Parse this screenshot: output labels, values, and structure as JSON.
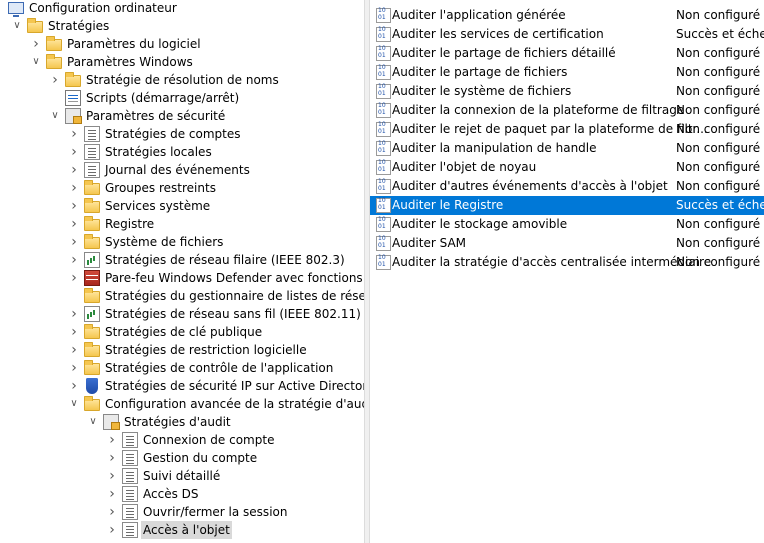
{
  "tree": [
    {
      "label": "Configuration ordinateur",
      "icon": "monitor-icon"
    },
    {
      "label": "Stratégies",
      "icon": "folder-icon",
      "expanded": true
    },
    {
      "label": "Paramètres du logiciel",
      "icon": "folder-icon",
      "expanded": false
    },
    {
      "label": "Paramètres Windows",
      "icon": "folder-icon",
      "expanded": true
    },
    {
      "label": "Stratégie de résolution de noms",
      "icon": "folder-icon",
      "expanded": false
    },
    {
      "label": "Scripts (démarrage/arrêt)",
      "icon": "script-icon"
    },
    {
      "label": "Paramètres de sécurité",
      "icon": "security-settings-icon",
      "expanded": true
    },
    {
      "label": "Stratégies de comptes",
      "icon": "policy-icon",
      "expanded": false
    },
    {
      "label": "Stratégies locales",
      "icon": "policy-icon",
      "expanded": false
    },
    {
      "label": "Journal des événements",
      "icon": "policy-icon",
      "expanded": false
    },
    {
      "label": "Groupes restreints",
      "icon": "lock-folder-icon",
      "expanded": false
    },
    {
      "label": "Services système",
      "icon": "lock-folder-icon",
      "expanded": false
    },
    {
      "label": "Registre",
      "icon": "lock-folder-icon",
      "expanded": false
    },
    {
      "label": "Système de fichiers",
      "icon": "lock-folder-icon",
      "expanded": false
    },
    {
      "label": "Stratégies de réseau filaire (IEEE 802.3)",
      "icon": "network-chart-icon",
      "expanded": false
    },
    {
      "label": "Pare-feu Windows Defender avec fonctions avancé",
      "icon": "firewall-icon",
      "expanded": false
    },
    {
      "label": "Stratégies du gestionnaire de listes de réseaux",
      "icon": "folder-icon"
    },
    {
      "label": "Stratégies de réseau sans fil (IEEE 802.11)",
      "icon": "network-chart-icon",
      "expanded": false
    },
    {
      "label": "Stratégies de clé publique",
      "icon": "folder-icon",
      "expanded": false
    },
    {
      "label": "Stratégies de restriction logicielle",
      "icon": "folder-icon",
      "expanded": false
    },
    {
      "label": "Stratégies de contrôle de l'application",
      "icon": "folder-icon",
      "expanded": false
    },
    {
      "label": "Stratégies de sécurité IP sur Active Directory (CON",
      "icon": "ip-security-icon",
      "expanded": false
    },
    {
      "label": "Configuration avancée de la stratégie d'audit",
      "icon": "folder-icon",
      "expanded": true
    },
    {
      "label": "Stratégies d'audit",
      "icon": "audit-policy-icon",
      "expanded": true
    },
    {
      "label": "Connexion de compte",
      "icon": "policy-icon",
      "expanded": false
    },
    {
      "label": "Gestion du compte",
      "icon": "policy-icon",
      "expanded": false
    },
    {
      "label": "Suivi détaillé",
      "icon": "policy-icon",
      "expanded": false
    },
    {
      "label": "Accès DS",
      "icon": "policy-icon",
      "expanded": false
    },
    {
      "label": "Ouvrir/fermer la session",
      "icon": "policy-icon",
      "expanded": false
    },
    {
      "label": "Accès à l'objet",
      "icon": "policy-icon",
      "expanded": false,
      "selected": true
    }
  ],
  "policies": [
    {
      "name": "Auditer l'application générée",
      "value": "Non configuré"
    },
    {
      "name": "Auditer les services de certification",
      "value": "Succès et échec"
    },
    {
      "name": "Auditer le partage de fichiers détaillé",
      "value": "Non configuré"
    },
    {
      "name": "Auditer le partage de fichiers",
      "value": "Non configuré"
    },
    {
      "name": "Auditer le système de fichiers",
      "value": "Non configuré"
    },
    {
      "name": "Auditer la connexion de la plateforme de filtrage",
      "value": "Non configuré"
    },
    {
      "name": "Auditer le rejet de paquet par la plateforme de filtr...",
      "value": "Non configuré"
    },
    {
      "name": "Auditer la manipulation de handle",
      "value": "Non configuré"
    },
    {
      "name": "Auditer l'objet de noyau",
      "value": "Non configuré"
    },
    {
      "name": "Auditer d'autres événements d'accès à l'objet",
      "value": "Non configuré"
    },
    {
      "name": "Auditer le Registre",
      "value": "Succès et échec",
      "selected": true
    },
    {
      "name": "Auditer le stockage amovible",
      "value": "Non configuré"
    },
    {
      "name": "Auditer SAM",
      "value": "Non configuré"
    },
    {
      "name": "Auditer la stratégie d'accès centralisée intermédiaire",
      "value": "Non configuré"
    }
  ],
  "colors": {
    "selection": "#0078d7",
    "tree_selection": "#d9d9d9"
  }
}
